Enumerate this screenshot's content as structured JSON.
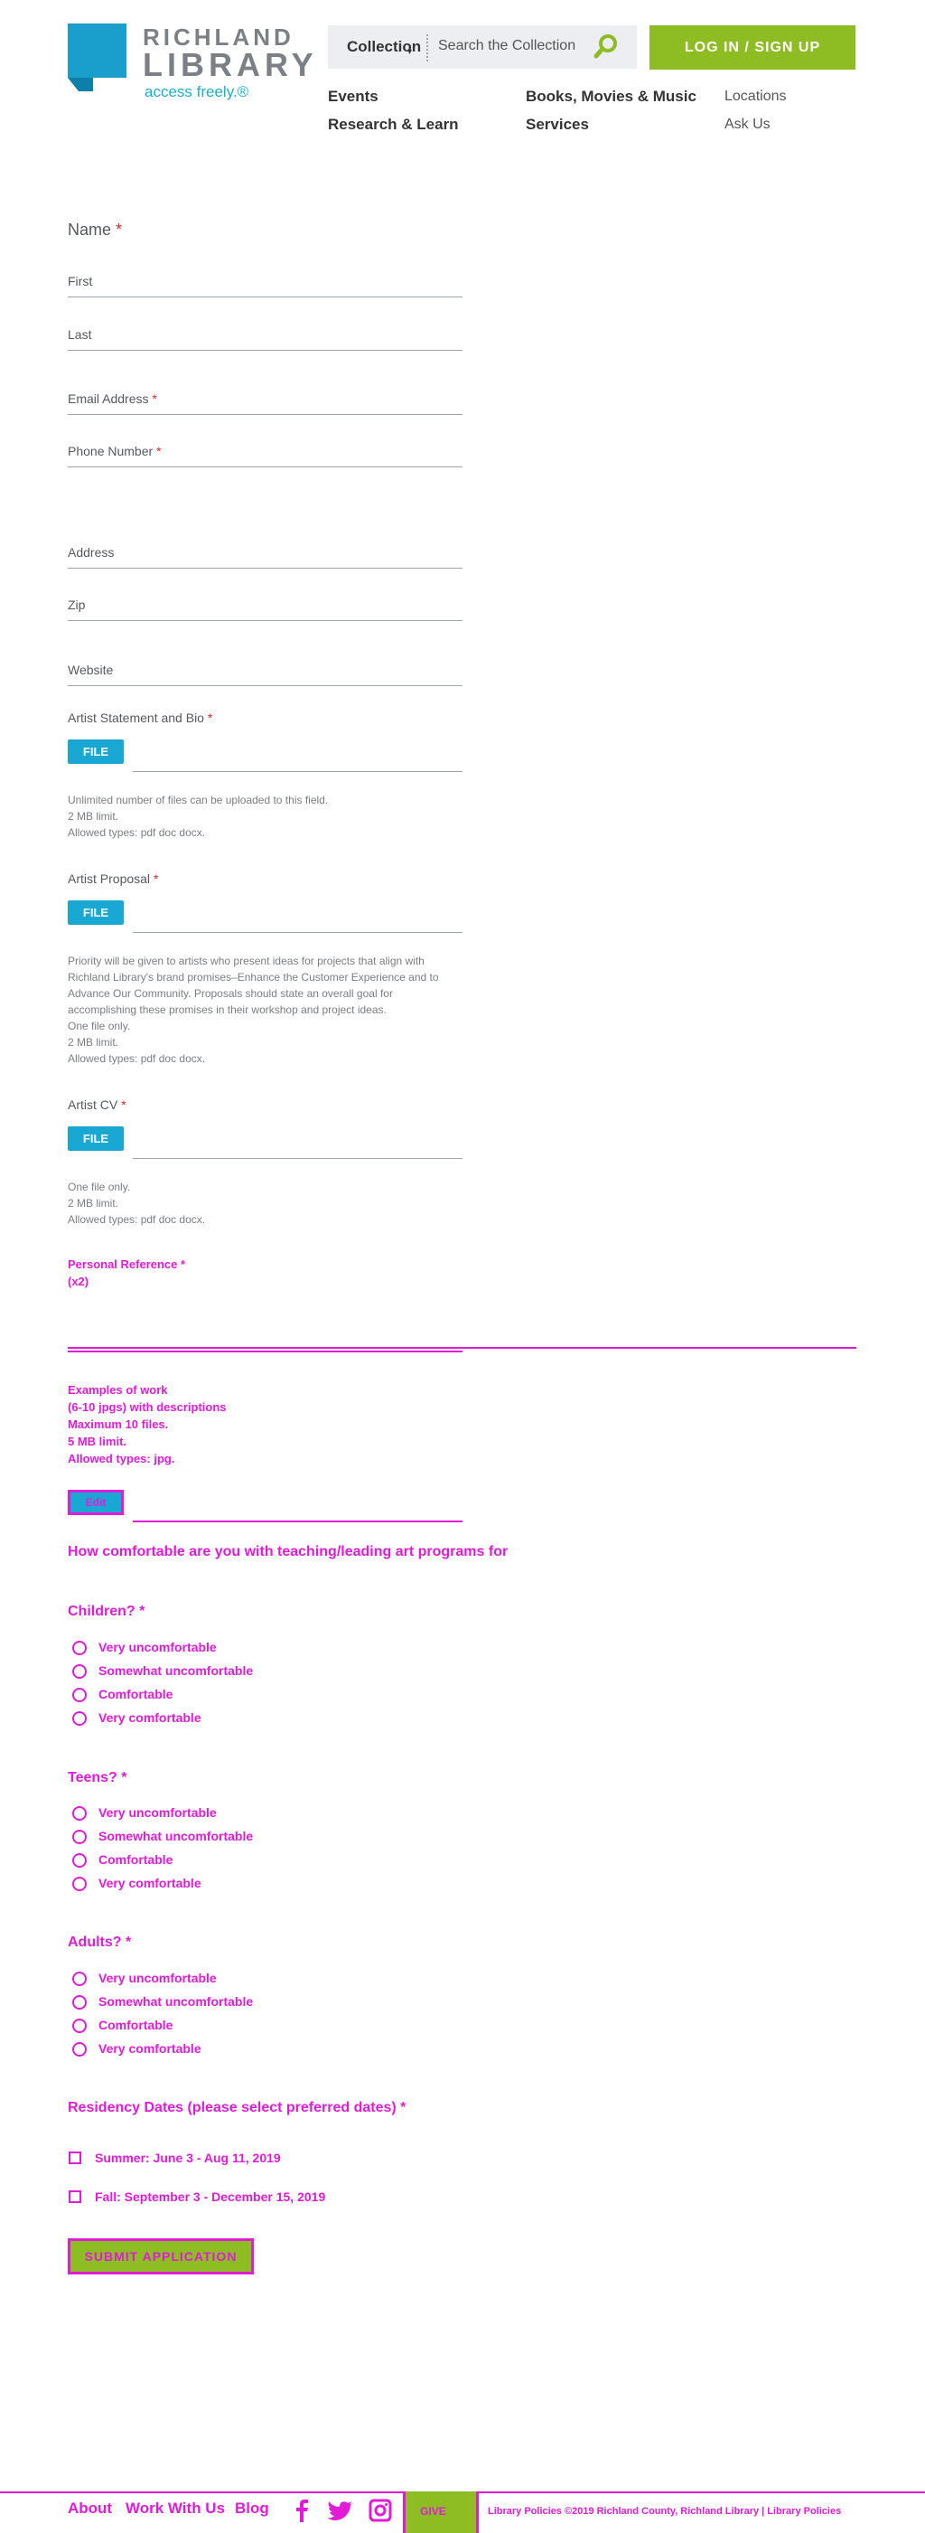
{
  "header": {
    "logo_line1": "RICHLAND",
    "logo_line2": "LIBRARY",
    "logo_tagline": "access freely.®",
    "search_scope": "Collection",
    "search_placeholder": "Search the Collection",
    "login_label": "LOG IN / SIGN UP",
    "nav": {
      "events": "Events",
      "books": "Books, Movies & Music",
      "locations": "Locations",
      "research": "Research & Learn",
      "services": "Services",
      "ask": "Ask Us"
    },
    "colors": {
      "accent_green": "#8ebd23",
      "accent_blue": "#1ab0cf"
    }
  },
  "form": {
    "name_label": "Name",
    "required_mark": "*",
    "first_placeholder": "First",
    "last_placeholder": "Last",
    "email_label": "Email Address",
    "phone_label": "Phone Number",
    "address_placeholder": "Address",
    "zip_placeholder": "Zip",
    "website_placeholder": "Website",
    "statement_label": "Artist Statement and Bio",
    "file_label": "FILE",
    "statement_help": [
      "Unlimited number of files can be uploaded to this field.",
      "2 MB limit.",
      "Allowed types: pdf doc docx."
    ],
    "proposal_label": "Artist Proposal",
    "proposal_help": [
      "Priority will be given to artists who present ideas for projects that align with",
      "Richland Library's brand promises–Enhance the Customer Experience and to",
      "Advance Our Community. Proposals should state an overall goal for",
      "accomplishing these promises in their workshop and project ideas.",
      "One file only.",
      "2 MB limit.",
      "Allowed types: pdf doc docx."
    ],
    "cv_label": "Artist CV",
    "cv_help": [
      "One file only.",
      "2 MB limit.",
      "Allowed types: pdf doc docx."
    ],
    "reference_label": "Personal Reference *",
    "reference_sub": "(x2)",
    "examples_help": [
      "Examples of work",
      "(6-10 jpgs) with descriptions",
      "Maximum 10 files.",
      "5 MB limit.",
      "Allowed types: jpg."
    ],
    "examples_button": "Edit",
    "comfort_question": "How comfortable are you with teaching/leading art programs for",
    "children_label": "Children? *",
    "teens_label": "Teens? *",
    "adults_label": "Adults? *",
    "options": [
      "Very uncomfortable",
      "Somewhat uncomfortable",
      "Comfortable",
      "Very comfortable"
    ],
    "dates_label": "Residency Dates (please select preferred dates) *",
    "date_summer": "Summer: June 3 - Aug 11, 2019",
    "date_fall": "Fall: September 3 - December 15, 2019",
    "submit_label": "SUBMIT APPLICATION"
  },
  "footer": {
    "about": "About",
    "work": "Work With Us",
    "blog": "Blog",
    "icons": [
      "facebook-icon",
      "twitter-icon",
      "instagram-icon"
    ],
    "box_label": "GIVE",
    "copyright": "Library Policies  ©2019 Richland County, Richland Library | Library Policies"
  }
}
